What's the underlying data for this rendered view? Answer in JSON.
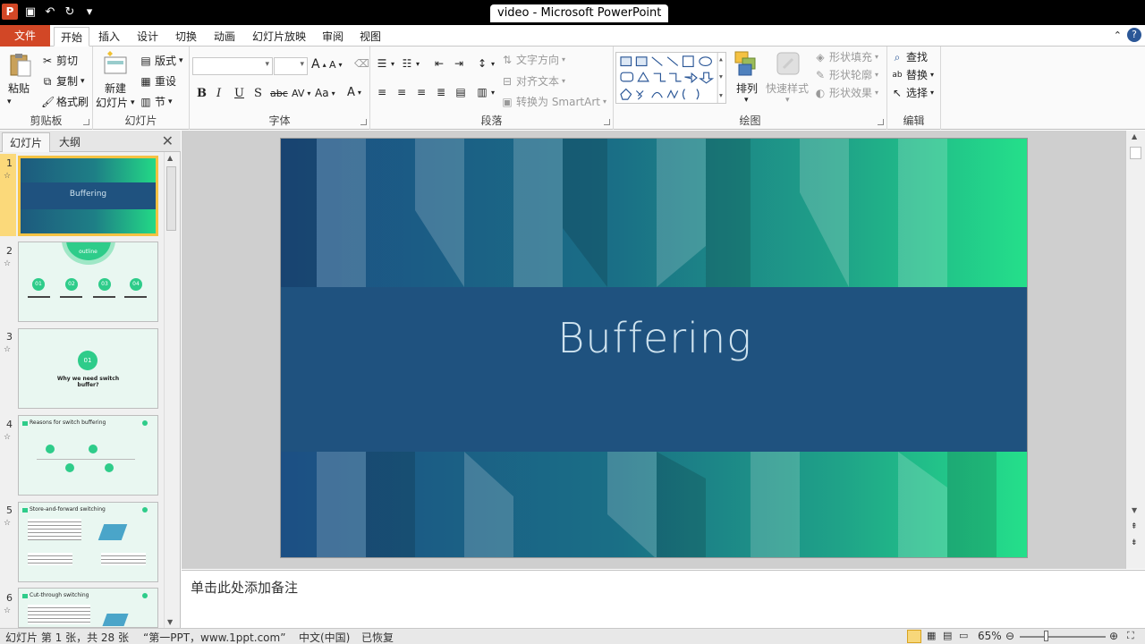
{
  "window": {
    "title": "video - Microsoft PowerPoint",
    "app_logo": "P"
  },
  "tabs": [
    "文件",
    "开始",
    "插入",
    "设计",
    "切换",
    "动画",
    "幻灯片放映",
    "审阅",
    "视图"
  ],
  "ribbon": {
    "clipboard": {
      "paste": "粘贴",
      "cut": "剪切",
      "copy": "复制",
      "format_painter": "格式刷",
      "label": "剪贴板"
    },
    "slides": {
      "new_slide": "新建",
      "new_slide2": "幻灯片",
      "layout": "版式",
      "reset": "重设",
      "section": "节",
      "label": "幻灯片"
    },
    "font": {
      "bold": "B",
      "italic": "I",
      "underline": "U",
      "shadow": "S",
      "strike": "abc",
      "spacing": "AV",
      "case": "Aa",
      "color": "A",
      "grow": "A",
      "shrink": "A",
      "label": "字体"
    },
    "paragraph": {
      "text_direction": "文字方向",
      "align_text": "对齐文本",
      "smartart": "转换为 SmartArt",
      "label": "段落"
    },
    "drawing": {
      "arrange": "排列",
      "quick_styles": "快速样式",
      "shape_fill": "形状填充",
      "shape_outline": "形状轮廓",
      "shape_effects": "形状效果",
      "label": "绘图"
    },
    "editing": {
      "find": "查找",
      "replace": "替换",
      "select": "选择",
      "label": "编辑"
    }
  },
  "pane": {
    "tab_slides": "幻灯片",
    "tab_outline": "大纲",
    "thumbnails": [
      {
        "num": "1",
        "title": "Buffering"
      },
      {
        "num": "2",
        "title": "outline",
        "items": [
          "01",
          "02",
          "03",
          "04"
        ]
      },
      {
        "num": "3",
        "badge": "01",
        "title": "Why we need switch buffer?"
      },
      {
        "num": "4",
        "title": "Reasons for switch buffering"
      },
      {
        "num": "5",
        "title": "Store-and-forward switching"
      },
      {
        "num": "6",
        "title": "Cut-through switching"
      }
    ]
  },
  "slide": {
    "title": "Buffering"
  },
  "notes": {
    "placeholder": "单击此处添加备注"
  },
  "status": {
    "slide_info": "幻灯片 第 1 张，共 28 张",
    "theme": "“第一PPT，www.1ppt.com”",
    "language": "中文(中国)",
    "recovered": "已恢复",
    "zoom": "65%"
  },
  "colors": {
    "file_tab": "#d24726",
    "slide_band": "#1f527f",
    "accent_green": "#2ecc8a"
  }
}
